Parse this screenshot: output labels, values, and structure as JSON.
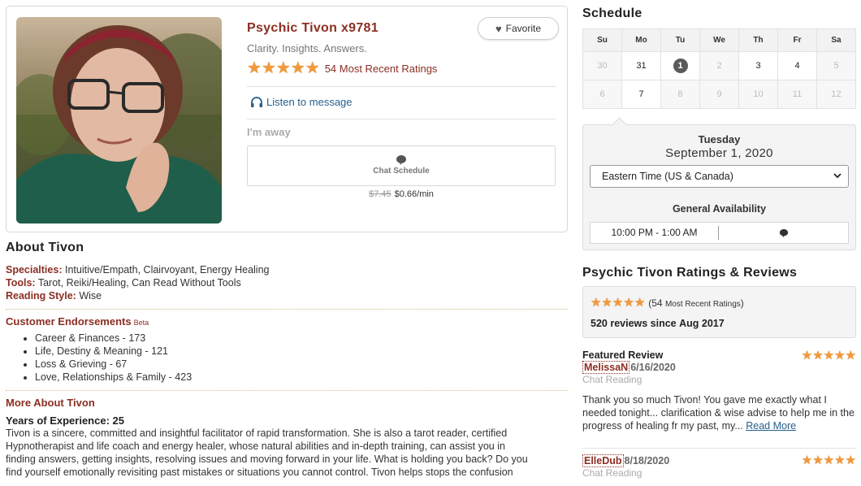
{
  "profile": {
    "name": "Psychic Tivon x9781",
    "tagline": "Clarity. Insights. Answers.",
    "rating_stars": 5,
    "rating_text": "54 Most Recent Ratings",
    "favorite_label": "Favorite",
    "listen_label": "Listen to message",
    "status": "I'm away",
    "chat_label": "Chat Schedule",
    "price_old": "$7.45",
    "price_new": "$0.66/min"
  },
  "about": {
    "title": "About Tivon",
    "specialties_label": "Specialties:",
    "specialties": "Intuitive/Empath, Clairvoyant, Energy Healing",
    "tools_label": "Tools:",
    "tools": "Tarot, Reiki/Healing, Can Read Without Tools",
    "style_label": "Reading Style:",
    "style": "Wise",
    "endorsements_title": "Customer Endorsements",
    "endorsements_beta": "Beta",
    "endorsements": [
      "Career & Finances - 173",
      "Life, Destiny & Meaning - 121",
      "Loss & Grieving - 67",
      "Love, Relationships & Family - 423"
    ],
    "more_title": "More About Tivon",
    "years": "Years of Experience: 25",
    "bio": [
      "Tivon is a sincere, committed and insightful facilitator of rapid transformation. She is also a tarot reader, certified",
      "Hypnotherapist and life coach and energy healer, whose natural abilities and in-depth training, can assist you in",
      "finding answers, getting insights, resolving issues and moving forward in your life. What is holding you back? Do you",
      "find yourself emotionally revisiting past mistakes or situations you cannot control. Tivon helps stops the confusion"
    ]
  },
  "schedule": {
    "title": "Schedule",
    "weekdays": [
      "Su",
      "Mo",
      "Tu",
      "We",
      "Th",
      "Fr",
      "Sa"
    ],
    "weeks": [
      [
        {
          "d": "30",
          "active": false,
          "today": false
        },
        {
          "d": "31",
          "active": true,
          "today": false
        },
        {
          "d": "1",
          "active": true,
          "today": true
        },
        {
          "d": "2",
          "active": false,
          "today": false
        },
        {
          "d": "3",
          "active": true,
          "today": false
        },
        {
          "d": "4",
          "active": true,
          "today": false
        },
        {
          "d": "5",
          "active": false,
          "today": false
        }
      ],
      [
        {
          "d": "6",
          "active": false,
          "today": false
        },
        {
          "d": "7",
          "active": true,
          "today": false
        },
        {
          "d": "8",
          "active": false,
          "today": false
        },
        {
          "d": "9",
          "active": false,
          "today": false
        },
        {
          "d": "10",
          "active": false,
          "today": false
        },
        {
          "d": "11",
          "active": false,
          "today": false
        },
        {
          "d": "12",
          "active": false,
          "today": false
        }
      ]
    ],
    "selected_day": "Tuesday",
    "selected_date": "September 1, 2020",
    "timezone": "Eastern Time (US & Canada)",
    "general_availability": "General Availability",
    "slot_time": "10:00 PM - 1:00 AM"
  },
  "ratings": {
    "title": "Psychic Tivon Ratings & Reviews",
    "count": "(54",
    "count_small": "Most Recent Ratings",
    "count_close": ")",
    "reviews_count": "520 reviews since",
    "since": "Aug 2017",
    "reviews": [
      {
        "featured": "Featured Review",
        "user": "MelissaN",
        "date": "6/16/2020",
        "type": "Chat Reading",
        "text": "Thank you so much Tivon! You gave me exactly what I needed tonight... clarification & wise advise to help me in the progress of healing fr my past, my...",
        "more": "Read More"
      },
      {
        "user": "ElleDub",
        "date": "8/18/2020",
        "type": "Chat Reading"
      }
    ]
  },
  "colors": {
    "accent": "#8b2e22",
    "star": "#f2993a",
    "link": "#275f8c"
  }
}
